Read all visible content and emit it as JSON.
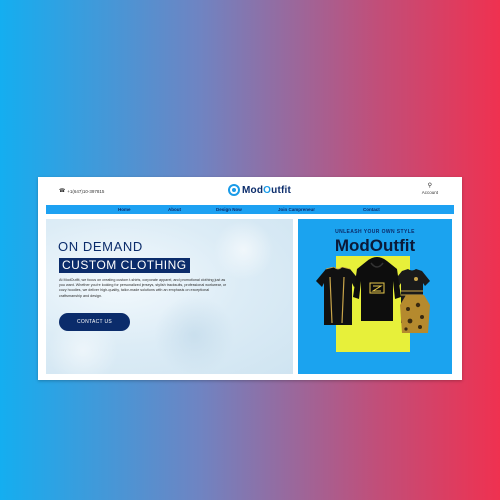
{
  "header": {
    "phone": "+1(647)10-397815",
    "logo": {
      "prefix": "Mod",
      "accent": "O",
      "suffix": "utfit"
    },
    "account_label": "Account"
  },
  "nav": {
    "items": [
      {
        "label": "Home"
      },
      {
        "label": "About"
      },
      {
        "label": "Design Now"
      },
      {
        "label": "Join Campreneur"
      },
      {
        "label": "Contact"
      }
    ]
  },
  "hero": {
    "heading_line1": "ON DEMAND",
    "heading_line2": "CUSTOM CLOTHING",
    "description": "At ModOutfit, we focus on creating custom t-shirts, corporate apparel, and promotional clothing just as you want. Whether you're looking for personalized jerseys, stylish tracksuits, professional workwear, or cozy hoodies, we deliver high-quality, tailor-made solutions with an emphasis on exceptional craftsmanship and design.",
    "cta_label": "CONTACT US"
  },
  "promo": {
    "tagline": "UNLEASH YOUR OWN STYLE",
    "brand": "ModOutfit"
  },
  "icons": {
    "phone": "phone-icon",
    "account": "user-icon",
    "logo": "logo-icon"
  },
  "colors": {
    "navy": "#0b2c6b",
    "nav_blue": "#1da1f2",
    "promo_blue": "#1ba3ef",
    "promo_yellow": "#e7f03a"
  }
}
